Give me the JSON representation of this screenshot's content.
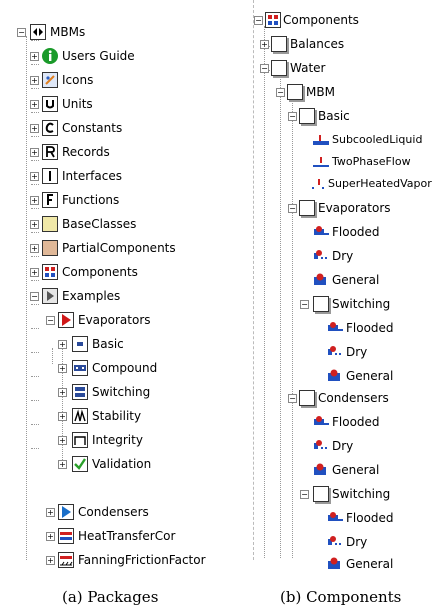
{
  "packages": {
    "root": {
      "label": "MBMs"
    },
    "items": [
      {
        "label": "Users Guide"
      },
      {
        "label": "Icons"
      },
      {
        "label": "Units"
      },
      {
        "label": "Constants"
      },
      {
        "label": "Records"
      },
      {
        "label": "Interfaces"
      },
      {
        "label": "Functions"
      },
      {
        "label": "BaseClasses"
      },
      {
        "label": "PartialComponents"
      },
      {
        "label": "Components"
      },
      {
        "label": "Examples"
      }
    ],
    "examples": {
      "evaporators": {
        "label": "Evaporators"
      },
      "evap_children": [
        {
          "label": "Basic"
        },
        {
          "label": "Compound"
        },
        {
          "label": "Switching"
        },
        {
          "label": "Stability"
        },
        {
          "label": "Integrity"
        },
        {
          "label": "Validation"
        }
      ],
      "others": [
        {
          "label": "Condensers"
        },
        {
          "label": "HeatTransferCor"
        },
        {
          "label": "FanningFrictionFactor"
        }
      ]
    },
    "caption": "(a) Packages"
  },
  "components": {
    "root": {
      "label": "Components"
    },
    "balances": {
      "label": "Balances"
    },
    "water": {
      "label": "Water"
    },
    "mbm": {
      "label": "MBM"
    },
    "basic": {
      "label": "Basic",
      "children": [
        {
          "label": "SubcooledLiquid"
        },
        {
          "label": "TwoPhaseFlow"
        },
        {
          "label": "SuperHeatedVapor"
        }
      ]
    },
    "evaporators": {
      "label": "Evaporators",
      "children": [
        {
          "label": "Flooded"
        },
        {
          "label": "Dry"
        },
        {
          "label": "General"
        }
      ],
      "switching": {
        "label": "Switching",
        "children": [
          {
            "label": "Flooded"
          },
          {
            "label": "Dry"
          },
          {
            "label": "General"
          }
        ]
      }
    },
    "condensers": {
      "label": "Condensers",
      "children": [
        {
          "label": "Flooded"
        },
        {
          "label": "Dry"
        },
        {
          "label": "General"
        }
      ],
      "switching": {
        "label": "Switching",
        "children": [
          {
            "label": "Flooded"
          },
          {
            "label": "Dry"
          },
          {
            "label": "General"
          }
        ]
      }
    },
    "caption": "(b) Components"
  },
  "icons": {
    "info": "info-icon",
    "package": "package-icon",
    "units": "units-icon",
    "constants": "constants-icon",
    "records": "records-icon",
    "interfaces": "interfaces-icon",
    "functions": "functions-icon",
    "component": "component-icon",
    "pump": "pump-icon"
  },
  "colors": {
    "info_green": "#1a9a2a",
    "play_red": "#d01818",
    "play_blue": "#1a6ec8",
    "base_classes": "#f0e8a8",
    "partial_components": "#e0b898",
    "check_green": "#2aa02a"
  }
}
